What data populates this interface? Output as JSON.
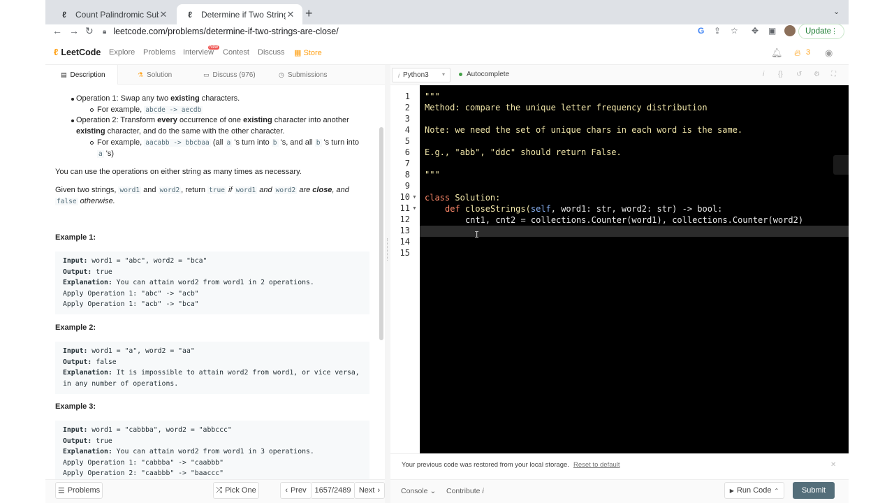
{
  "browser": {
    "tabs": [
      {
        "title": "Count Palindromic Subsequenc"
      },
      {
        "title": "Determine if Two Strings Are C"
      }
    ],
    "url": "leetcode.com/problems/determine-if-two-strings-are-close/",
    "update_label": "Update"
  },
  "nav": {
    "brand": "LeetCode",
    "links": [
      "Explore",
      "Problems",
      "Interview",
      "Contest",
      "Discuss",
      "Store"
    ],
    "new_badge": "New",
    "streak": "3"
  },
  "left_tabs": [
    {
      "label": "Description"
    },
    {
      "label": "Solution"
    },
    {
      "label": "Discuss (976)"
    },
    {
      "label": "Submissions"
    }
  ],
  "description": {
    "op1_prefix": "Operation 1: Swap any two ",
    "op1_bold": "existing",
    "op1_suffix": " characters.",
    "op1_example_prefix": "For example, ",
    "op1_example_code": "abcde -> aecdb",
    "op2_prefix": "Operation 2: Transform ",
    "op2_bold1": "every",
    "op2_mid": " occurrence of one ",
    "op2_bold2": "existing",
    "op2_suffix": " character into another",
    "op2_line2_bold": "existing",
    "op2_line2": " character, and do the same with the other character.",
    "op2_example_prefix": "For example, ",
    "op2_example_code": "aacabb -> bbcbaa",
    "op2_example_mid1": " (all ",
    "op2_code_a": "a",
    "op2_example_mid2": " 's turn into ",
    "op2_code_b": "b",
    "op2_example_mid3": " 's, and all ",
    "op2_code_b2": "b",
    "op2_example_mid4": " 's turn into",
    "op2_code_a2": "a",
    "op2_example_end": " 's)",
    "para1": "You can use the operations on either string as many times as necessary.",
    "para2_prefix": "Given two strings, ",
    "code_word1": "word1",
    "and1": " and ",
    "code_word2": "word2",
    "para2_mid": ", return ",
    "code_true": "true",
    "para2_if": " if ",
    "code_word1b": "word1",
    "para2_and": " and ",
    "code_word2b": "word2",
    "para2_are": " are ",
    "para2_close": "close",
    "para2_and2": ", and",
    "code_false": "false",
    "para2_otherwise": " otherwise."
  },
  "examples": [
    {
      "heading": "Example 1:",
      "lines": [
        {
          "k": "Input:",
          "v": " word1 = \"abc\", word2 = \"bca\""
        },
        {
          "k": "Output:",
          "v": " true"
        },
        {
          "k": "Explanation:",
          "v": " You can attain word2 from word1 in 2 operations."
        },
        {
          "k": "",
          "v": "Apply Operation 1: \"abc\" -> \"acb\""
        },
        {
          "k": "",
          "v": "Apply Operation 1: \"acb\" -> \"bca\""
        }
      ]
    },
    {
      "heading": "Example 2:",
      "lines": [
        {
          "k": "Input:",
          "v": " word1 = \"a\", word2 = \"aa\""
        },
        {
          "k": "Output:",
          "v": " false"
        },
        {
          "k": "Explanation:",
          "v": " It is impossible to attain word2 from word1, or vice versa,"
        },
        {
          "k": "",
          "v": "in any number of operations."
        }
      ]
    },
    {
      "heading": "Example 3:",
      "lines": [
        {
          "k": "Input:",
          "v": " word1 = \"cabbba\", word2 = \"abbccc\""
        },
        {
          "k": "Output:",
          "v": " true"
        },
        {
          "k": "Explanation:",
          "v": " You can attain word2 from word1 in 3 operations."
        },
        {
          "k": "",
          "v": "Apply Operation 1: \"cabbba\" -> \"caabbb\""
        },
        {
          "k": "",
          "v": "Apply Operation 2: \"caabbb\" -> \"baaccc\""
        }
      ]
    }
  ],
  "left_bar": {
    "problems": "Problems",
    "pick_one": "Pick One",
    "prev": "Prev",
    "counter": "1657/2489",
    "next": "Next"
  },
  "editor": {
    "language": "Python3",
    "autocomplete": "Autocomplete",
    "line_numbers": [
      "1",
      "2",
      "3",
      "4",
      "5",
      "6",
      "7",
      "8",
      "9",
      "10",
      "11",
      "12",
      "13",
      "14",
      "15"
    ],
    "code": {
      "l1": "\"\"\"",
      "l2": "Method: compare the unique letter frequency distribution",
      "l4": "Note: we need the set of unique chars in each word is the same.",
      "l6": "E.g., \"abb\", \"ddc\" should return False.",
      "l8": "\"\"\"",
      "l10_kw": "class",
      "l10_name": " Solution:",
      "l11_kw": "def",
      "l11_name": " closeStrings(",
      "l11_self": "self",
      "l11_rest": ", word1: str, word2: str) -> bool:",
      "l12": "cnt1, cnt2 = collections.Counter(word1), collections.Counter(word2)"
    }
  },
  "restore": {
    "message": "Your previous code was restored from your local storage.",
    "reset": "Reset to default"
  },
  "right_bar": {
    "console": "Console",
    "contribute": "Contribute",
    "run": "Run Code",
    "submit": "Submit"
  }
}
